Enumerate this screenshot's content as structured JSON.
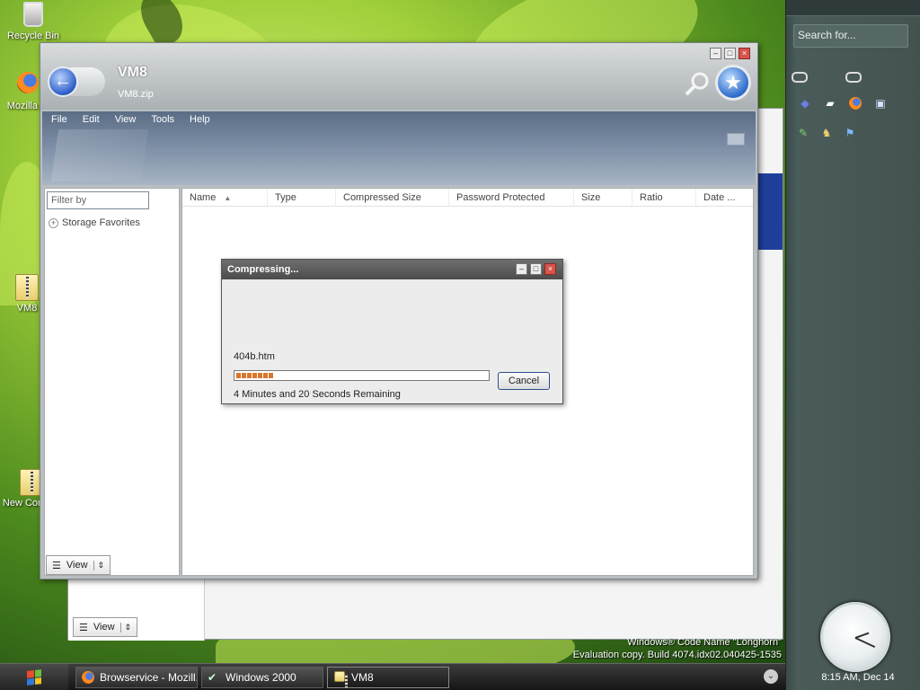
{
  "desktop": {
    "icons": [
      {
        "label": "Recycle Bin",
        "icon": "recycle-bin-icon"
      },
      {
        "label": "Mozilla Fi",
        "icon": "firefox-icon"
      },
      {
        "label": "VM8",
        "icon": "zip-folder-icon"
      },
      {
        "label": "New Compre",
        "icon": "zip-folder-icon"
      }
    ],
    "watermark_line1": "Windows® Code Name \"Longhorn\"",
    "watermark_line2": "Evaluation copy. Build 4074.idx02.040425-1535"
  },
  "sidebar": {
    "search_placeholder": "Search for...",
    "clock_label": "8:15 AM, Dec 14"
  },
  "main_window": {
    "title": "VM8",
    "subtitle": "VM8.zip",
    "menu": [
      "File",
      "Edit",
      "View",
      "Tools",
      "Help"
    ],
    "filter_placeholder": "Filter by",
    "storage_favorites": "Storage Favorites",
    "view_button": "View",
    "columns": [
      "Name",
      "Type",
      "Compressed Size",
      "Password Protected",
      "Size",
      "Ratio",
      "Date ..."
    ]
  },
  "back_window": {
    "view_button": "View"
  },
  "dialog": {
    "title": "Compressing...",
    "file": "404b.htm",
    "progress_fraction": 0.15,
    "cancel_label": "Cancel",
    "remaining": "4 Minutes and 20 Seconds Remaining"
  },
  "taskbar": {
    "tasks": [
      {
        "label": "Browservice - Mozill...",
        "icon": "firefox-icon"
      },
      {
        "label": "Windows 2000",
        "icon": "remote-desktop-icon"
      },
      {
        "label": "VM8",
        "icon": "zip-folder-icon"
      }
    ]
  },
  "colors": {
    "progress": "#d9762b",
    "title_bar": "#4b4b4b",
    "sidebar": "#44524f"
  }
}
